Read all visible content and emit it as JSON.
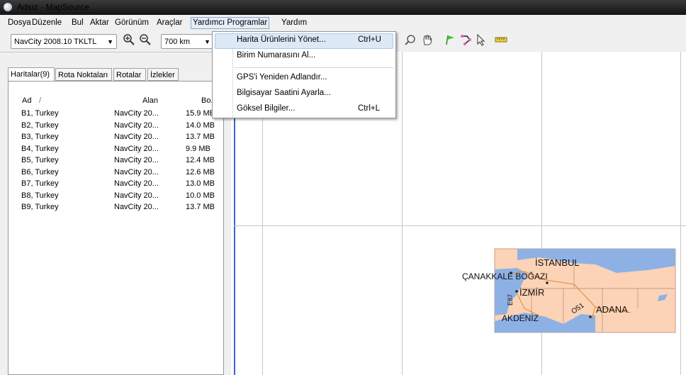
{
  "window": {
    "title": "Adsız - MapSource"
  },
  "menu": {
    "items": [
      "Dosya",
      "Düzenle",
      "Bul",
      "Aktar",
      "Görünüm",
      "Araçlar",
      "Yardımcı Programlar",
      "Yardım"
    ],
    "open_menu": "Yardımcı Programlar"
  },
  "toolbar": {
    "map_product": "NavCity 2008.10 TKLTL",
    "zoom_level": "700 km"
  },
  "dropdown": {
    "items": [
      {
        "label": "Harita Ürünlerini Yönet...",
        "shortcut": "Ctrl+U"
      },
      {
        "label": "Birim Numarasını Al...",
        "shortcut": ""
      },
      {
        "label": "GPS'i Yeniden Adlandır...",
        "shortcut": ""
      },
      {
        "label": "Bilgisayar Saatini Ayarla...",
        "shortcut": ""
      },
      {
        "label": "Göksel Bilgiler...",
        "shortcut": "Ctrl+L"
      }
    ]
  },
  "tabs": [
    "Haritalar(9)",
    "Rota Noktaları",
    "Rotalar",
    "İzlekler"
  ],
  "maps_table": {
    "headers": {
      "name": "Ad",
      "sort_indicator": "/",
      "area": "Alan",
      "size": "Bo."
    },
    "rows": [
      {
        "name": "B1, Turkey",
        "area": "NavCity 20...",
        "size": "15.9 MB"
      },
      {
        "name": "B2, Turkey",
        "area": "NavCity 20...",
        "size": "14.0 MB"
      },
      {
        "name": "B3, Turkey",
        "area": "NavCity 20...",
        "size": "13.7 MB"
      },
      {
        "name": "B4, Turkey",
        "area": "NavCity 20...",
        "size": "9.9 MB"
      },
      {
        "name": "B5, Turkey",
        "area": "NavCity 20...",
        "size": "12.4 MB"
      },
      {
        "name": "B6, Turkey",
        "area": "NavCity 20...",
        "size": "12.6 MB"
      },
      {
        "name": "B7, Turkey",
        "area": "NavCity 20...",
        "size": "13.0 MB"
      },
      {
        "name": "B8, Turkey",
        "area": "NavCity 20...",
        "size": "10.0 MB"
      },
      {
        "name": "B9, Turkey",
        "area": "NavCity 20...",
        "size": "13.7 MB"
      }
    ]
  },
  "map": {
    "labels": {
      "istanbul": "İSTANBUL",
      "canakkale": "ÇANAKKALE BOĞAZI",
      "izmir": "İZMİR",
      "adana": "ADANA",
      "akdeniz": "AKDENİZ",
      "e87": "E87",
      "o51": "O51"
    }
  },
  "colors": {
    "titlebar": "#1e1e1e",
    "land": "#fcd3b6",
    "water": "#8eb1e5",
    "highlight": "#dce8f6"
  }
}
